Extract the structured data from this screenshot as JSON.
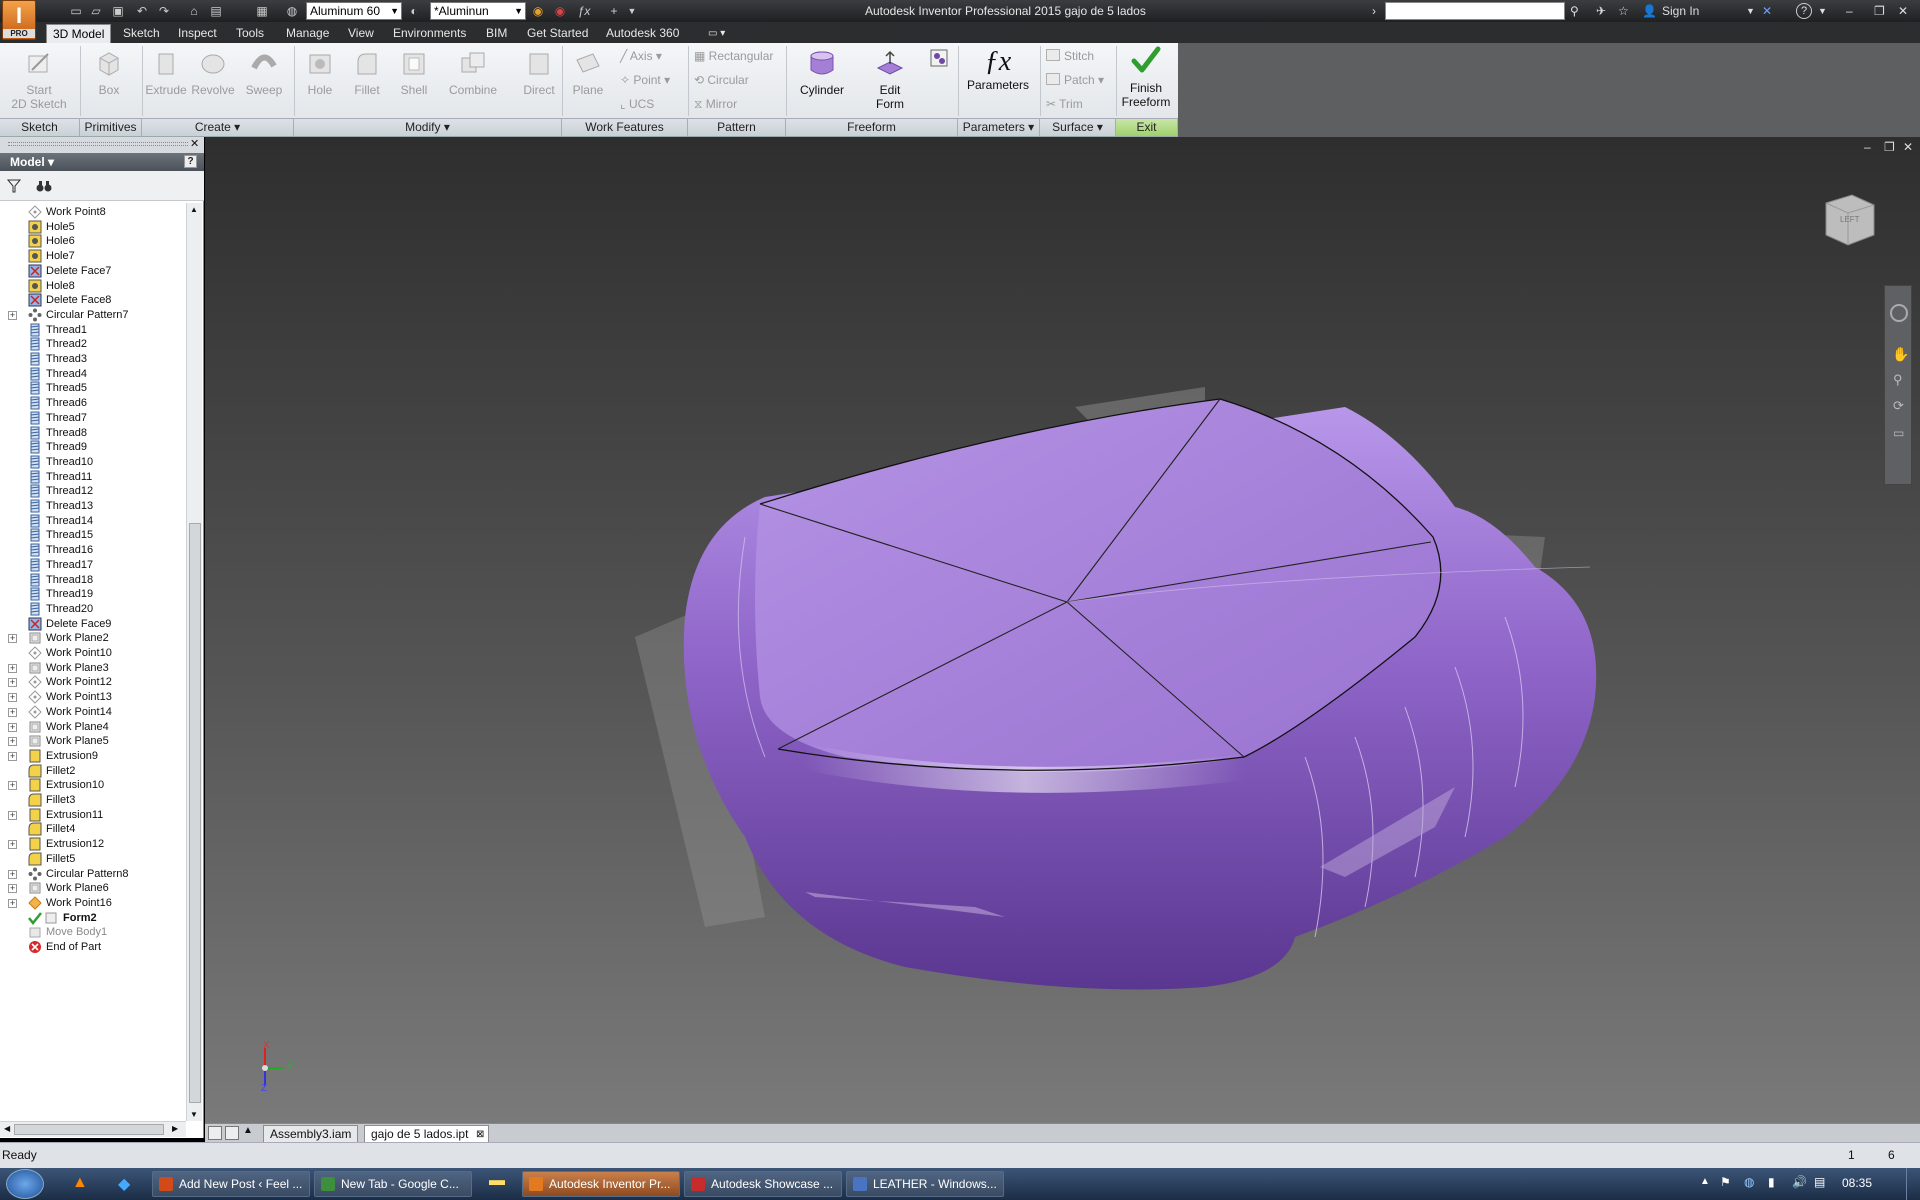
{
  "titlebar": {
    "logo_text": "I",
    "logo_sub": "PRO",
    "material_select": "Aluminum 60",
    "appearance_select": "*Aluminun",
    "fx_glyph": "ƒx",
    "window_title": "Autodesk Inventor Professional 2015    gajo de 5 lados",
    "sign_in": "Sign In",
    "help": "?"
  },
  "tabs": [
    "3D Model",
    "Sketch",
    "Inspect",
    "Tools",
    "Manage",
    "View",
    "Environments",
    "BIM",
    "Get Started",
    "Autodesk 360"
  ],
  "ribbon": {
    "sketch": {
      "start_2d_sketch": "Start\n2D Sketch",
      "group": "Sketch"
    },
    "primitives": {
      "box": "Box",
      "group": "Primitives"
    },
    "create": {
      "extrude": "Extrude",
      "revolve": "Revolve",
      "sweep": "Sweep",
      "group": "Create ▾"
    },
    "modify": {
      "hole": "Hole",
      "fillet": "Fillet",
      "shell": "Shell",
      "combine": "Combine",
      "direct": "Direct",
      "group": "Modify ▾"
    },
    "work_features": {
      "plane": "Plane",
      "axis": "Axis",
      "point": "Point",
      "ucs": "UCS",
      "group": "Work Features"
    },
    "pattern": {
      "rectangular": "Rectangular",
      "circular": "Circular",
      "mirror": "Mirror",
      "group": "Pattern"
    },
    "freeform": {
      "cylinder": "Cylinder",
      "edit_form": "Edit\nForm",
      "group": "Freeform"
    },
    "parameters": {
      "fx": "ƒx",
      "parameters": "Parameters",
      "group": "Parameters ▾"
    },
    "surface": {
      "stitch": "Stitch",
      "patch": "Patch",
      "trim": "Trim",
      "group": "Surface ▾"
    },
    "exit": {
      "finish_freeform": "Finish\nFreeform",
      "group": "Exit"
    }
  },
  "browser": {
    "header": "Model ▾",
    "help": "?",
    "nodes": [
      {
        "label": "Work Point8",
        "icon": "work-point",
        "exp": false
      },
      {
        "label": "Hole5",
        "icon": "hole",
        "exp": false
      },
      {
        "label": "Hole6",
        "icon": "hole",
        "exp": false
      },
      {
        "label": "Hole7",
        "icon": "hole",
        "exp": false
      },
      {
        "label": "Delete Face7",
        "icon": "delete-face",
        "exp": false
      },
      {
        "label": "Hole8",
        "icon": "hole",
        "exp": false
      },
      {
        "label": "Delete Face8",
        "icon": "delete-face",
        "exp": false
      },
      {
        "label": "Circular Pattern7",
        "icon": "circular-pattern",
        "exp": true
      },
      {
        "label": "Thread1",
        "icon": "thread",
        "exp": false
      },
      {
        "label": "Thread2",
        "icon": "thread",
        "exp": false
      },
      {
        "label": "Thread3",
        "icon": "thread",
        "exp": false
      },
      {
        "label": "Thread4",
        "icon": "thread",
        "exp": false
      },
      {
        "label": "Thread5",
        "icon": "thread",
        "exp": false
      },
      {
        "label": "Thread6",
        "icon": "thread",
        "exp": false
      },
      {
        "label": "Thread7",
        "icon": "thread",
        "exp": false
      },
      {
        "label": "Thread8",
        "icon": "thread",
        "exp": false
      },
      {
        "label": "Thread9",
        "icon": "thread",
        "exp": false
      },
      {
        "label": "Thread10",
        "icon": "thread",
        "exp": false
      },
      {
        "label": "Thread11",
        "icon": "thread",
        "exp": false
      },
      {
        "label": "Thread12",
        "icon": "thread",
        "exp": false
      },
      {
        "label": "Thread13",
        "icon": "thread",
        "exp": false
      },
      {
        "label": "Thread14",
        "icon": "thread",
        "exp": false
      },
      {
        "label": "Thread15",
        "icon": "thread",
        "exp": false
      },
      {
        "label": "Thread16",
        "icon": "thread",
        "exp": false
      },
      {
        "label": "Thread17",
        "icon": "thread",
        "exp": false
      },
      {
        "label": "Thread18",
        "icon": "thread",
        "exp": false
      },
      {
        "label": "Thread19",
        "icon": "thread",
        "exp": false
      },
      {
        "label": "Thread20",
        "icon": "thread",
        "exp": false
      },
      {
        "label": "Delete Face9",
        "icon": "delete-face",
        "exp": false
      },
      {
        "label": "Work Plane2",
        "icon": "work-plane",
        "exp": true
      },
      {
        "label": "Work Point10",
        "icon": "work-point",
        "exp": false
      },
      {
        "label": "Work Plane3",
        "icon": "work-plane",
        "exp": true
      },
      {
        "label": "Work Point12",
        "icon": "work-point",
        "exp": true
      },
      {
        "label": "Work Point13",
        "icon": "work-point",
        "exp": true
      },
      {
        "label": "Work Point14",
        "icon": "work-point",
        "exp": true
      },
      {
        "label": "Work Plane4",
        "icon": "work-plane",
        "exp": true
      },
      {
        "label": "Work Plane5",
        "icon": "work-plane",
        "exp": true
      },
      {
        "label": "Extrusion9",
        "icon": "extrusion",
        "exp": true
      },
      {
        "label": "Fillet2",
        "icon": "fillet",
        "exp": false
      },
      {
        "label": "Extrusion10",
        "icon": "extrusion",
        "exp": true
      },
      {
        "label": "Fillet3",
        "icon": "fillet",
        "exp": false
      },
      {
        "label": "Extrusion11",
        "icon": "extrusion",
        "exp": true
      },
      {
        "label": "Fillet4",
        "icon": "fillet",
        "exp": false
      },
      {
        "label": "Extrusion12",
        "icon": "extrusion",
        "exp": true
      },
      {
        "label": "Fillet5",
        "icon": "fillet",
        "exp": false
      },
      {
        "label": "Circular Pattern8",
        "icon": "circular-pattern",
        "exp": true
      },
      {
        "label": "Work Plane6",
        "icon": "work-plane",
        "exp": true
      },
      {
        "label": "Work Point16",
        "icon": "work-point-orange",
        "exp": true
      },
      {
        "label": "Form2",
        "icon": "form",
        "exp": false,
        "bold": true
      },
      {
        "label": "Move Body1",
        "icon": "move-body",
        "exp": false,
        "grey": true
      },
      {
        "label": "End of Part",
        "icon": "end-of-part",
        "exp": false
      }
    ]
  },
  "viewcube": {
    "face_label": "LEFT"
  },
  "triad": {
    "x": "X",
    "y": "Y",
    "z": "Z"
  },
  "document_tabs": [
    {
      "label": "Assembly3.iam",
      "active": false
    },
    {
      "label": "gajo de 5 lados.ipt",
      "active": true
    }
  ],
  "status": {
    "text": "Ready",
    "count1": "1",
    "count2": "6"
  },
  "taskbar": {
    "items": [
      {
        "label": "Add New Post ‹ Feel ...",
        "active": false,
        "color": "#d24a1a"
      },
      {
        "label": "New Tab - Google C...",
        "active": false,
        "color": "#3d8f3d"
      },
      {
        "label": "Autodesk Inventor Pr...",
        "active": true,
        "color": "#e27a22"
      },
      {
        "label": "Autodesk Showcase ...",
        "active": false,
        "color": "#c62c2c"
      },
      {
        "label": "LEATHER - Windows...",
        "active": false,
        "color": "#4a74c2"
      }
    ],
    "clock": "08:35"
  },
  "colors": {
    "model": "#a57fd6",
    "model_dark": "#6f49a6",
    "finish_green": "#2f9d2f"
  }
}
